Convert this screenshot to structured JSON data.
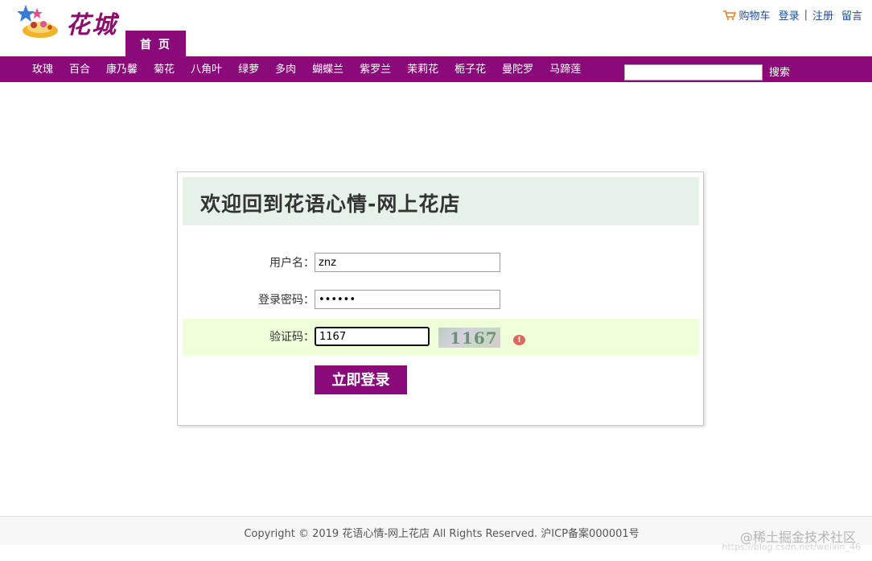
{
  "header": {
    "logo_text": "花城",
    "home_tab": "首 页",
    "links": {
      "cart": "购物车",
      "login": "登录",
      "register": "注册",
      "message": "留言",
      "separator": "|"
    }
  },
  "nav": {
    "items": [
      "玫瑰",
      "百合",
      "康乃馨",
      "菊花",
      "八角叶",
      "绿萝",
      "多肉",
      "蝴蝶兰",
      "紫罗兰",
      "茉莉花",
      "栀子花",
      "曼陀罗",
      "马蹄莲"
    ],
    "search_value": "",
    "search_button": "搜索"
  },
  "login": {
    "title": "欢迎回到花语心情-网上花店",
    "username_label": "用户名：",
    "username_value": "znz",
    "password_label": "登录密码：",
    "password_value": "••••••",
    "captcha_label": "验证码：",
    "captcha_value": "1167",
    "captcha_image_text": "1167",
    "error_icon": "!",
    "submit": "立即登录"
  },
  "footer": {
    "copyright": "Copyright © 2019 花语心情-网上花店 All Rights Reserved. 沪ICP备案000001号"
  },
  "watermark": {
    "text": "@稀土掘金技术社区",
    "url": "https://blog.csdn.net/weixin_46"
  },
  "colors": {
    "brand_purple": "#8b0a7a",
    "title_bg": "#e6f2e8",
    "captcha_row_bg": "#eeffd9",
    "link_blue": "#1a4f9c"
  },
  "icons": [
    "cart-icon",
    "error-icon",
    "logo-icon"
  ]
}
